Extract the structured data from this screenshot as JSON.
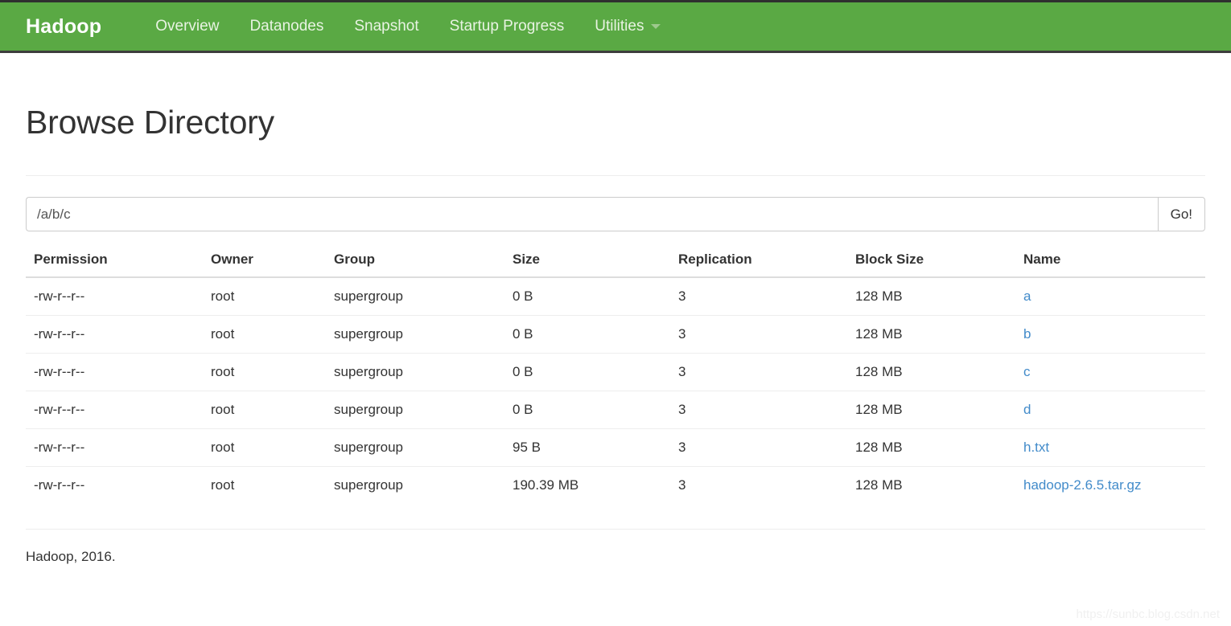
{
  "navbar": {
    "brand": "Hadoop",
    "items": [
      {
        "label": "Overview",
        "has_caret": false
      },
      {
        "label": "Datanodes",
        "has_caret": false
      },
      {
        "label": "Snapshot",
        "has_caret": false
      },
      {
        "label": "Startup Progress",
        "has_caret": false
      },
      {
        "label": "Utilities",
        "has_caret": true
      }
    ],
    "background_color": "#5aa944",
    "brand_color": "#ffffff",
    "link_color": "#e8f3e2"
  },
  "page": {
    "title": "Browse Directory"
  },
  "path_bar": {
    "value": "/a/b/c",
    "placeholder": "/a/b/c",
    "go_label": "Go!"
  },
  "table": {
    "headers": [
      "Permission",
      "Owner",
      "Group",
      "Size",
      "Replication",
      "Block Size",
      "Name"
    ],
    "rows": [
      {
        "permission": "-rw-r--r--",
        "owner": "root",
        "group": "supergroup",
        "size": "0 B",
        "replication": "3",
        "block_size": "128 MB",
        "name": "a"
      },
      {
        "permission": "-rw-r--r--",
        "owner": "root",
        "group": "supergroup",
        "size": "0 B",
        "replication": "3",
        "block_size": "128 MB",
        "name": "b"
      },
      {
        "permission": "-rw-r--r--",
        "owner": "root",
        "group": "supergroup",
        "size": "0 B",
        "replication": "3",
        "block_size": "128 MB",
        "name": "c"
      },
      {
        "permission": "-rw-r--r--",
        "owner": "root",
        "group": "supergroup",
        "size": "0 B",
        "replication": "3",
        "block_size": "128 MB",
        "name": "d"
      },
      {
        "permission": "-rw-r--r--",
        "owner": "root",
        "group": "supergroup",
        "size": "95 B",
        "replication": "3",
        "block_size": "128 MB",
        "name": "h.txt"
      },
      {
        "permission": "-rw-r--r--",
        "owner": "root",
        "group": "supergroup",
        "size": "190.39 MB",
        "replication": "3",
        "block_size": "128 MB",
        "name": "hadoop-2.6.5.tar.gz"
      }
    ],
    "link_color": "#428bca"
  },
  "footer": {
    "text": "Hadoop, 2016."
  },
  "watermark": {
    "text": "https://sunbc.blog.csdn.net"
  }
}
